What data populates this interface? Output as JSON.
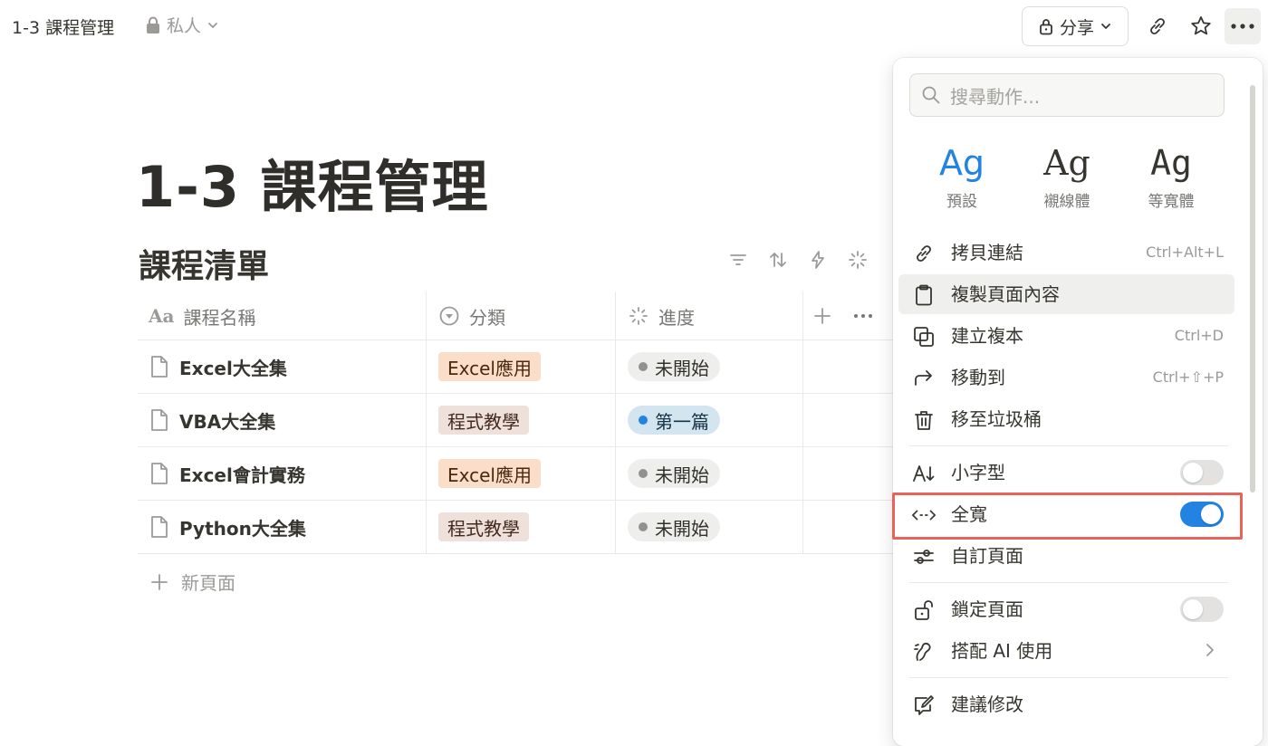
{
  "topbar": {
    "page_title": "1-3 課程管理",
    "privacy_label": "私人",
    "share_label": "分享"
  },
  "page": {
    "title": "1-3 課程管理",
    "database_title": "課程清單",
    "columns": [
      "課程名稱",
      "分類",
      "進度"
    ],
    "rows": [
      {
        "name": "Excel大全集",
        "category": "Excel應用",
        "category_style": "excel",
        "status": "未開始",
        "status_style": "gray"
      },
      {
        "name": "VBA大全集",
        "category": "程式教學",
        "category_style": "prog",
        "status": "第一篇",
        "status_style": "blue"
      },
      {
        "name": "Excel會計實務",
        "category": "Excel應用",
        "category_style": "excel",
        "status": "未開始",
        "status_style": "gray"
      },
      {
        "name": "Python大全集",
        "category": "程式教學",
        "category_style": "prog",
        "status": "未開始",
        "status_style": "gray"
      }
    ],
    "new_page_label": "新頁面"
  },
  "menu": {
    "search_placeholder": "搜尋動作...",
    "font_glyph": "Ag",
    "fonts": [
      {
        "label": "預設",
        "selected": true
      },
      {
        "label": "襯線體",
        "selected": false
      },
      {
        "label": "等寬體",
        "selected": false
      }
    ],
    "items": {
      "copy_link": {
        "label": "拷貝連結",
        "shortcut": "Ctrl+Alt+L"
      },
      "copy_content": {
        "label": "複製頁面內容"
      },
      "duplicate": {
        "label": "建立複本",
        "shortcut": "Ctrl+D"
      },
      "move_to": {
        "label": "移動到",
        "shortcut": "Ctrl+⇧+P"
      },
      "trash": {
        "label": "移至垃圾桶"
      },
      "small_text": {
        "label": "小字型",
        "on": false
      },
      "full_width": {
        "label": "全寬",
        "on": true
      },
      "customize": {
        "label": "自訂頁面"
      },
      "lock": {
        "label": "鎖定頁面",
        "on": false
      },
      "ai": {
        "label": "搭配 AI 使用"
      },
      "suggest": {
        "label": "建議修改"
      }
    }
  },
  "colors": {
    "accent": "#2383e2",
    "highlight_border": "#e8635a",
    "tag_excel_bg": "#fadec9",
    "tag_prog_bg": "#eee0da",
    "status_gray_dot": "#91918e",
    "status_blue_dot": "#2383e2"
  }
}
